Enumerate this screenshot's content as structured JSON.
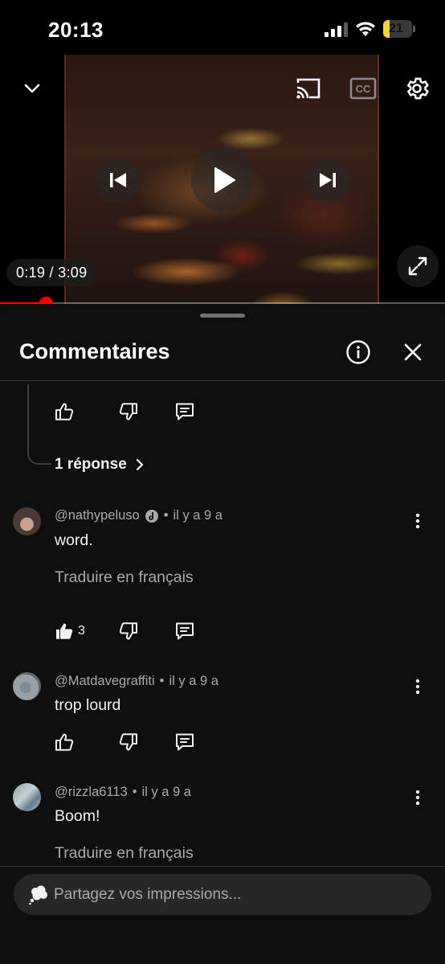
{
  "status_bar": {
    "time": "20:13",
    "battery_level": "21",
    "battery_color": "#f2d53c"
  },
  "player": {
    "current_time": "0:19",
    "separator": " / ",
    "duration": "3:09",
    "progress_fraction": 0.102,
    "accent_color": "#ff0000",
    "icons": [
      "chevron-down-icon",
      "cast-icon",
      "cc-icon",
      "settings-gear-icon",
      "previous-icon",
      "play-icon",
      "next-icon",
      "fullscreen-icon"
    ]
  },
  "comments_panel": {
    "title": "Commentaires",
    "icons": [
      "info-icon",
      "close-icon"
    ],
    "replies_link": "1 réponse",
    "comments": [
      {
        "author": "@nathypeluso",
        "verified": true,
        "time_ago": "il y a 9 a",
        "text": "word.",
        "translate": "Traduire en français",
        "like_count": "3",
        "liked": true
      },
      {
        "author": "@Matdavegraffiti",
        "verified": false,
        "time_ago": "il y a 9 a",
        "text": "trop lourd",
        "like_count": "",
        "liked": false
      },
      {
        "author": "@rizzla6113",
        "verified": false,
        "time_ago": "il y a 9 a",
        "text": "Boom!",
        "translate": "Traduire en français",
        "like_count": "",
        "liked": false
      }
    ]
  },
  "composer": {
    "placeholder": "Partagez vos impressions..."
  }
}
